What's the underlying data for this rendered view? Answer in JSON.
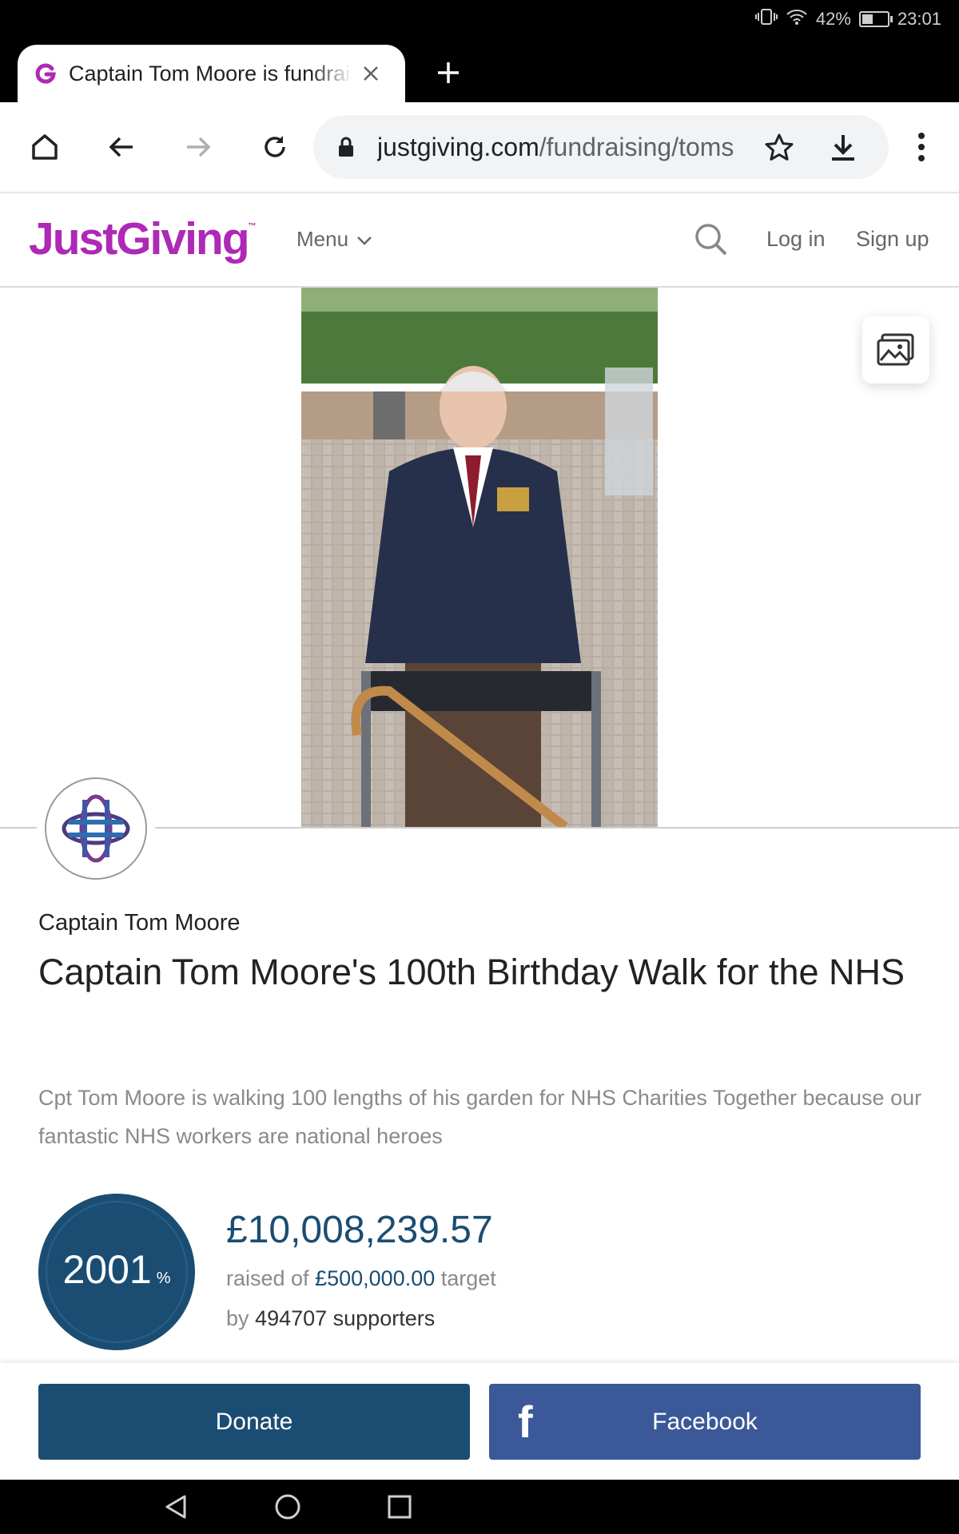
{
  "status_bar": {
    "battery_percent": "42%",
    "battery_level": 0.42,
    "time": "23:01"
  },
  "browser": {
    "tab_title": "Captain Tom Moore is fundraising for NHS Charities Together",
    "url_host": "justgiving.com",
    "url_path": "/fundraising/toms"
  },
  "site": {
    "logo_text": "JustGiving",
    "logo_tm": "™",
    "brand_color": "#ad29b6",
    "menu_label": "Menu",
    "login_label": "Log in",
    "signup_label": "Sign up"
  },
  "page": {
    "owner_name": "Captain Tom Moore",
    "title": "Captain Tom Moore's 100th Birthday Walk for the NHS",
    "summary": "Cpt Tom Moore is walking 100 lengths of his garden for NHS Charities Together because our fantastic NHS workers are national heroes",
    "progress_percent": "2001",
    "percent_sign": "%",
    "amount_raised": "£10,008,239.57",
    "raised_of_label": "raised of",
    "target_amount": "£500,000.00",
    "target_label": "target",
    "by_label": "by",
    "supporters_text": "494707 supporters",
    "accent_color": "#1b4d72"
  },
  "actions": {
    "donate_label": "Donate",
    "facebook_label": "Facebook",
    "facebook_icon_glyph": "f",
    "facebook_color": "#3b5998"
  },
  "icons": {
    "status": [
      "vibrate-icon",
      "wifi-icon",
      "battery-icon"
    ],
    "toolbar": [
      "home-icon",
      "back-icon",
      "forward-icon",
      "reload-icon",
      "lock-icon",
      "star-icon",
      "download-icon",
      "more-vert-icon"
    ],
    "nav": [
      "nav-back-icon",
      "nav-home-icon",
      "nav-recents-icon"
    ]
  }
}
